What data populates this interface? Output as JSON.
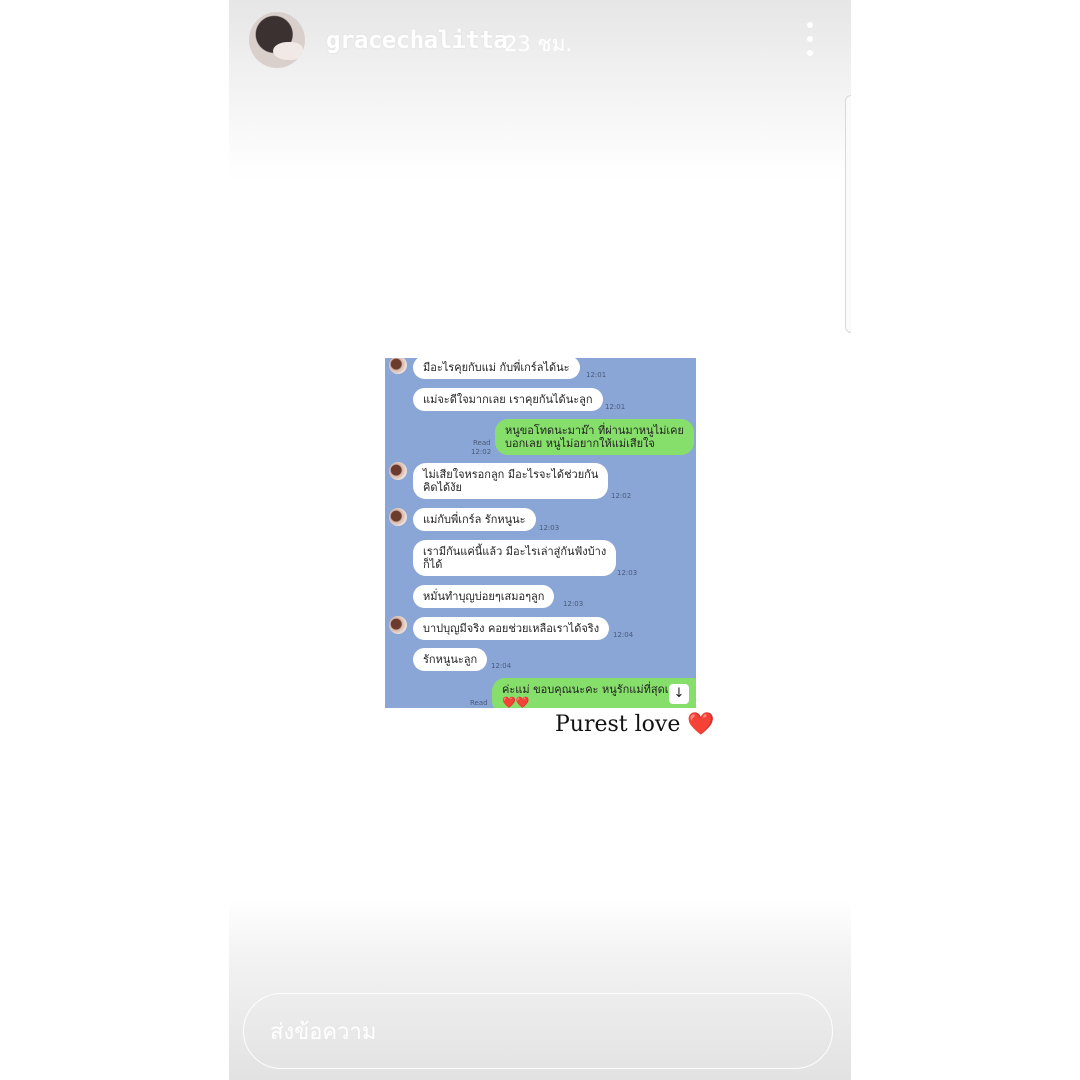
{
  "header": {
    "username": "gracechalitta",
    "time": "23 ชม."
  },
  "chat": {
    "messages": [
      {
        "text": "มีอะไรคุยกับแม่ กับพี่เกร์ลได้นะ",
        "time": "12:01"
      },
      {
        "text": "แม่จะดีใจมากเลย เราคุยกันได้นะลูก",
        "time": "12:01"
      },
      {
        "text_line1": "หนูขอโทดนะมาม๊า ที่ผ่านมาหนูไม่เคย",
        "text_line2": "บอกเลย หนูไม่อยากให้แม่เสียใจ",
        "read": "Read",
        "time": "12:02"
      },
      {
        "text_line1": "ไม่เสียใจหรอกลูก มีอะไรจะได้ช่วยกัน",
        "text_line2": "คิดได้งัย",
        "time": "12:02"
      },
      {
        "text": "แม่กับพี่เกร์ล รักหนูนะ",
        "time": "12:03"
      },
      {
        "text_line1": "เรามีกันแค่นี้แล้ว มีอะไรเล่าสู่กันฟังบ้าง",
        "text_line2": "ก็ได้",
        "time": "12:03"
      },
      {
        "text": "หมั่นทำบุญบ่อยๆเสมอๆลูก",
        "time": "12:03"
      },
      {
        "text": "บาปบุญมีจริง คอยช่วยเหลือเราได้จริง",
        "time": "12:04"
      },
      {
        "text": "รักหนูนะลูก",
        "time": "12:04"
      },
      {
        "text_line1": "ค่ะแม่ ขอบคุณนะคะ หนูรักแม่ที่สุดเล",
        "hearts": "❤️❤️",
        "read": "Read"
      }
    ],
    "scroll_glyph": "↓"
  },
  "caption": {
    "text": "Purest love",
    "emoji": "❤️"
  },
  "reply": {
    "placeholder": "ส่งข้อความ"
  }
}
